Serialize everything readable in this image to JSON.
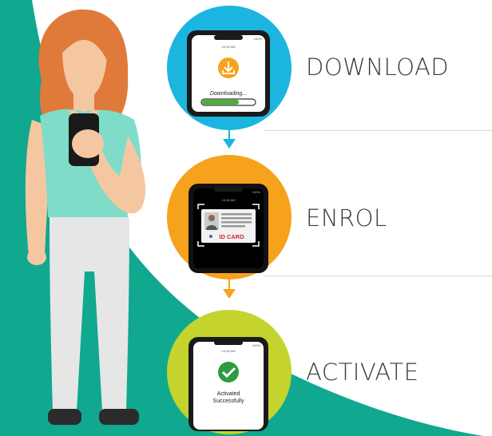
{
  "colors": {
    "teal": "#10a88f",
    "download_circle": "#1cb5e0",
    "enrol_circle": "#f6a21c",
    "activate_circle": "#c4d32e",
    "arrow": "#1cb5e0",
    "label_text": "#3a3a3a",
    "hair": "#e07a3a",
    "shirt": "#7fdcc8",
    "pants": "#e6e6e6",
    "skin": "#f4c7a1"
  },
  "steps": [
    {
      "label": "DOWNLOAD",
      "icon": "download-icon",
      "screen": {
        "status_time": "10:30 AM",
        "battery": "100%",
        "caption": "Downloading...",
        "progress": 0.7
      }
    },
    {
      "label": "ENROL",
      "icon": "id-card-icon",
      "screen": {
        "status_time": "10:30 AM",
        "battery": "100%",
        "card_label": "ID CARD"
      }
    },
    {
      "label": "ACTIVATE",
      "icon": "check-circle-icon",
      "screen": {
        "status_time": "10:30 AM",
        "battery": "100%",
        "caption_line1": "Activated",
        "caption_line2": "Successfully"
      }
    }
  ]
}
